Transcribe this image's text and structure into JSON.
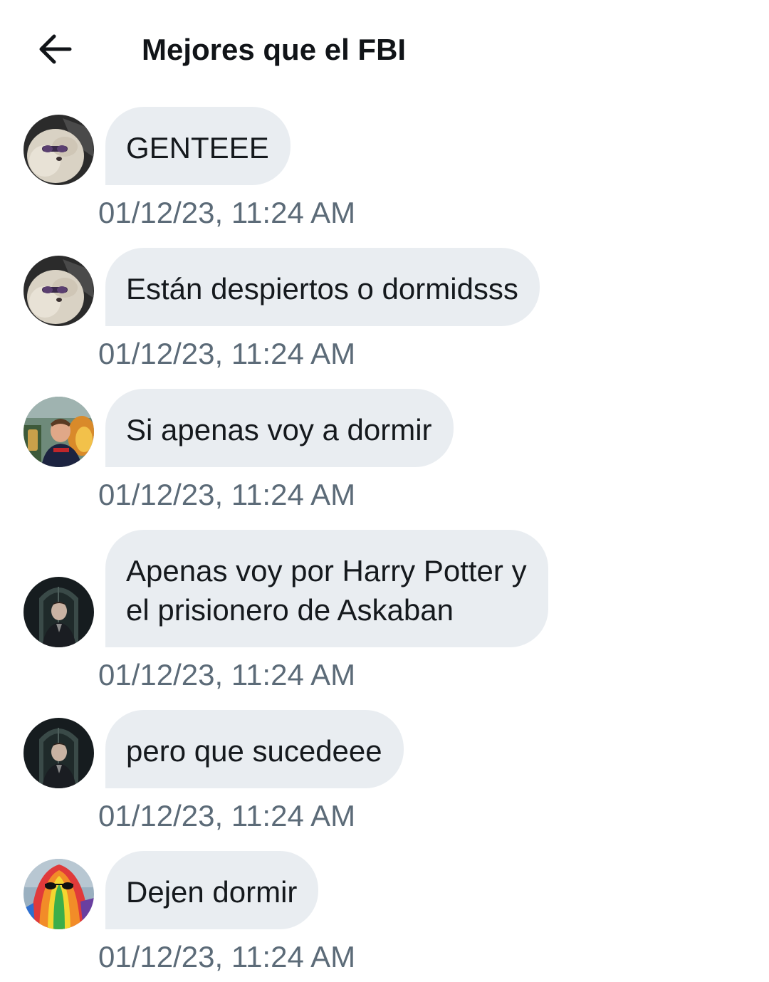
{
  "header": {
    "back_icon": "arrow-left-icon",
    "title": "Mejores que el FBI"
  },
  "messages": [
    {
      "avatar": "avatar-white-dog-sunglasses",
      "text": "GENTEEE",
      "time": "01/12/23, 11:24 AM"
    },
    {
      "avatar": "avatar-white-dog-sunglasses",
      "text": "Están despiertos o dormidsss",
      "time": "01/12/23, 11:24 AM"
    },
    {
      "avatar": "avatar-man-selfie-fire",
      "text": "Si apenas voy a dormir",
      "time": "01/12/23, 11:24 AM"
    },
    {
      "avatar": "avatar-boy-gothic-window",
      "text_line1": "Apenas voy por Harry Potter y",
      "text_line2": "el prisionero de Askaban",
      "time": "01/12/23, 11:24 AM"
    },
    {
      "avatar": "avatar-boy-gothic-window",
      "text": "pero que sucedeee",
      "time": "01/12/23, 11:24 AM"
    },
    {
      "avatar": "avatar-rainbow-ghost",
      "text": "Dejen dormir",
      "time": "01/12/23, 11:24 AM"
    }
  ],
  "colors": {
    "bubble": "#e9edf1",
    "timestamp": "#5c6b78",
    "text": "#15191d"
  }
}
